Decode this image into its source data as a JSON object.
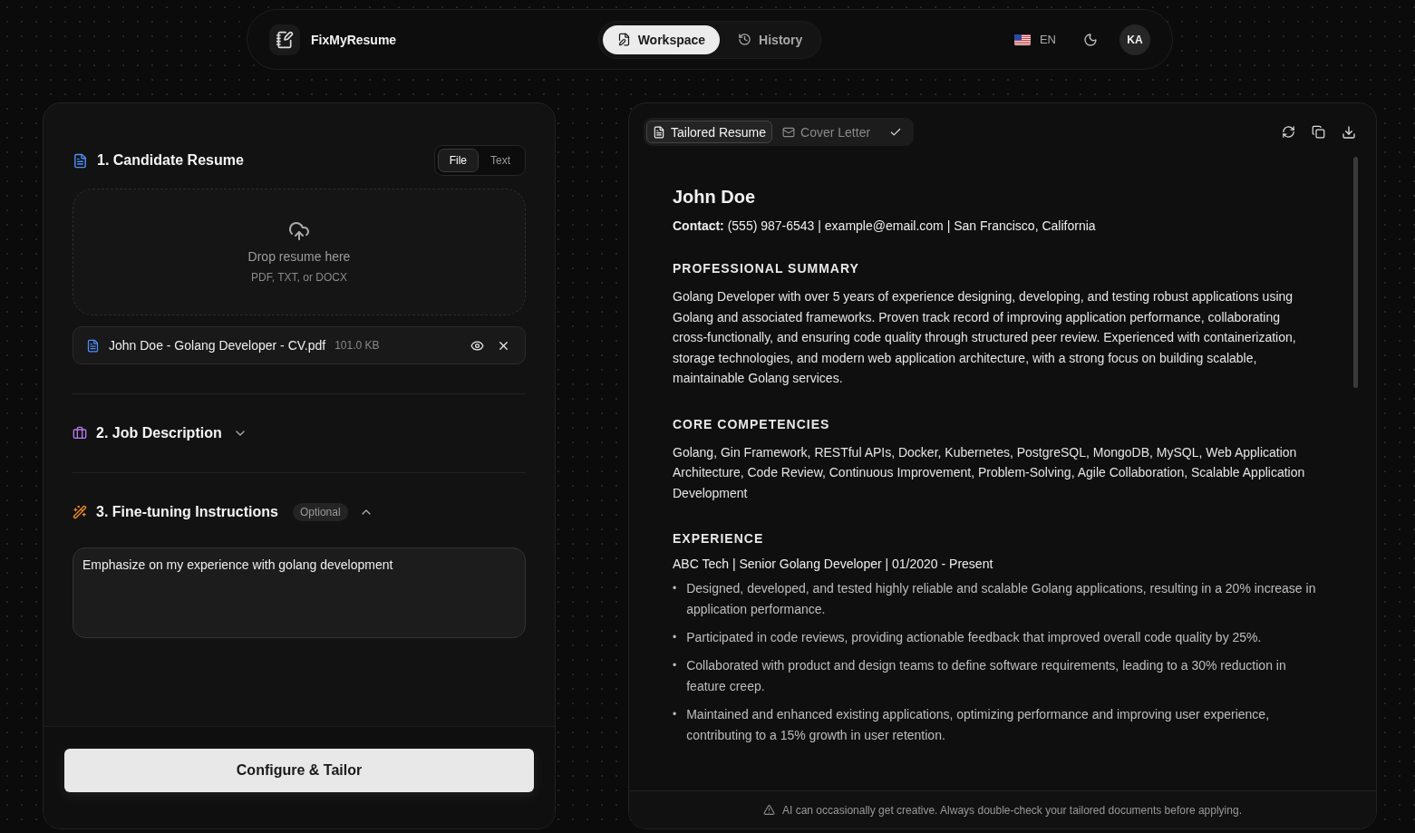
{
  "header": {
    "brand": "FixMyResume",
    "nav": [
      {
        "label": "Workspace",
        "selected": true
      },
      {
        "label": "History",
        "selected": false
      }
    ],
    "language": "EN",
    "avatar": "KA"
  },
  "resume_section": {
    "title": "1. Candidate Resume",
    "modes": [
      {
        "label": "File",
        "selected": true
      },
      {
        "label": "Text",
        "selected": false
      }
    ],
    "dropzone": {
      "title": "Drop resume here",
      "hint": "PDF, TXT, or DOCX"
    },
    "file": {
      "name": "John Doe - Golang Developer - CV.pdf",
      "size": "101.0 KB"
    }
  },
  "job_section": {
    "title": "2. Job Description",
    "expanded": false
  },
  "tuning_section": {
    "title": "3. Fine-tuning Instructions",
    "badge": "Optional",
    "expanded": true,
    "value": "Emphasize on my experience with golang development"
  },
  "submit": "Configure & Tailor",
  "preview": {
    "tabs": [
      {
        "label": "Tailored Resume",
        "selected": true
      },
      {
        "label": "Cover Letter",
        "selected": false
      }
    ],
    "resume": {
      "name": "John Doe",
      "contact_label": "Contact:",
      "contact": "(555) 987-6543 | example@email.com | San Francisco, California",
      "sections": [
        {
          "kind": "paragraph",
          "heading": "PROFESSIONAL SUMMARY",
          "text": "Golang Developer with over 5 years of experience designing, developing, and testing robust applications using Golang and associated frameworks. Proven track record of improving application performance, collaborating cross-functionally, and ensuring code quality through structured peer review. Experienced with containerization, storage technologies, and modern web application architecture, with a strong focus on building scalable, maintainable Golang services."
        },
        {
          "kind": "paragraph",
          "heading": "CORE COMPETENCIES",
          "text": "Golang, Gin Framework, RESTful APIs, Docker, Kubernetes, PostgreSQL, MongoDB, MySQL, Web Application Architecture, Code Review, Continuous Improvement, Problem-Solving, Agile Collaboration, Scalable Application Development"
        },
        {
          "kind": "experience",
          "heading": "EXPERIENCE",
          "role": "ABC Tech | Senior Golang Developer | 01/2020 - Present",
          "marker": "•",
          "bullets": [
            "Designed, developed, and tested highly reliable and scalable Golang applications, resulting in a 20% increase in application performance.",
            "Participated in code reviews, providing actionable feedback that improved overall code quality by 25%.",
            "Collaborated with product and design teams to define software requirements, leading to a 30% reduction in feature creep.",
            "Maintained and enhanced existing applications, optimizing performance and improving user experience, contributing to a 15% growth in user retention."
          ]
        }
      ]
    }
  },
  "footer_note": "AI can occasionally get creative. Always double-check your tailored documents before applying."
}
